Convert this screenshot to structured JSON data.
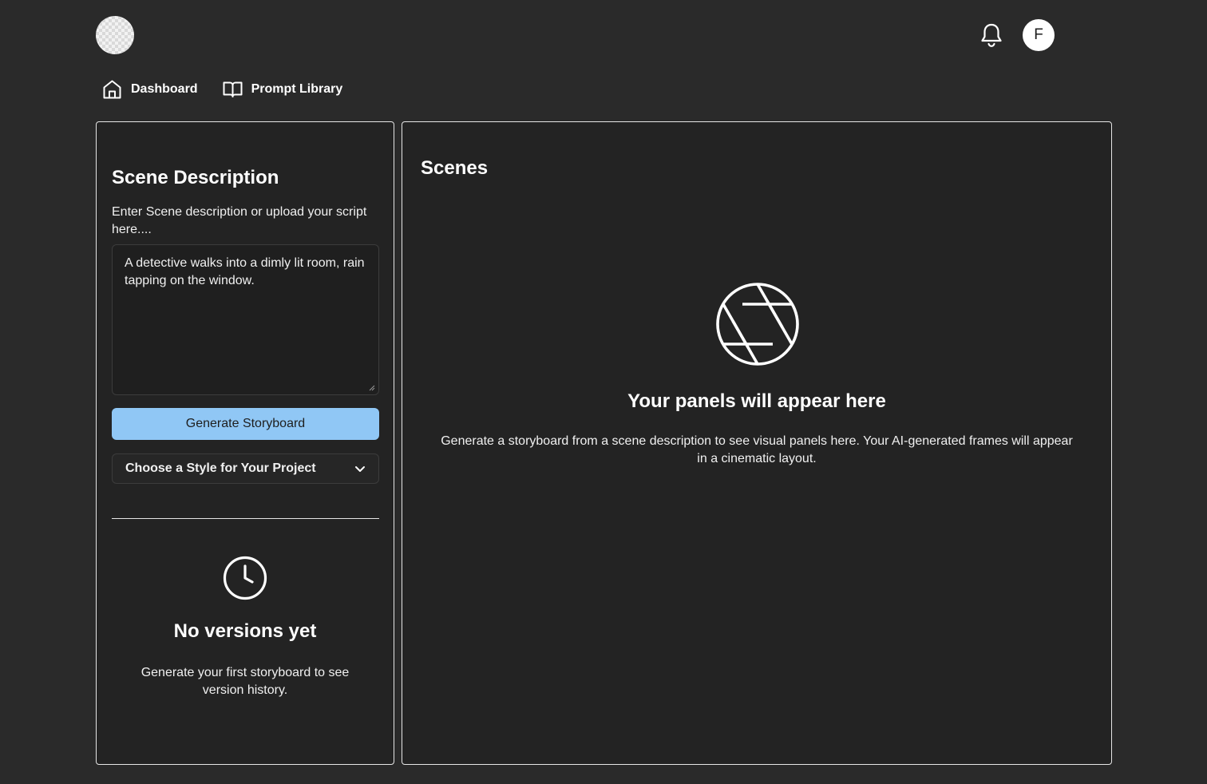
{
  "header": {
    "logo_icon": "checkered-logo-icon",
    "notifications_icon": "bell-icon",
    "avatar_initial": "F"
  },
  "nav": {
    "items": [
      {
        "label": "Dashboard",
        "icon": "home-icon"
      },
      {
        "label": "Prompt Library",
        "icon": "book-icon"
      }
    ]
  },
  "left_panel": {
    "title": "Scene Description",
    "subtitle": "Enter Scene description or upload your script here....",
    "textarea_value": "A detective walks into a dimly lit room, rain tapping on the window.",
    "generate_label": "Generate Storyboard",
    "style_select_label": "Choose a Style for Your Project",
    "empty_icon": "clock-icon",
    "empty_title": "No versions yet",
    "empty_subtitle": "Generate your first storyboard to see version history."
  },
  "right_panel": {
    "title": "Scenes",
    "empty_icon": "aperture-icon",
    "empty_title": "Your panels will appear here",
    "empty_subtitle": "Generate a storyboard from a scene description to see visual panels here. Your AI-generated frames will appear in a cinematic layout."
  },
  "colors": {
    "background": "#2a2a2a",
    "panel": "#232323",
    "accent_button": "#90c7f5",
    "border": "#e6e6e6"
  }
}
